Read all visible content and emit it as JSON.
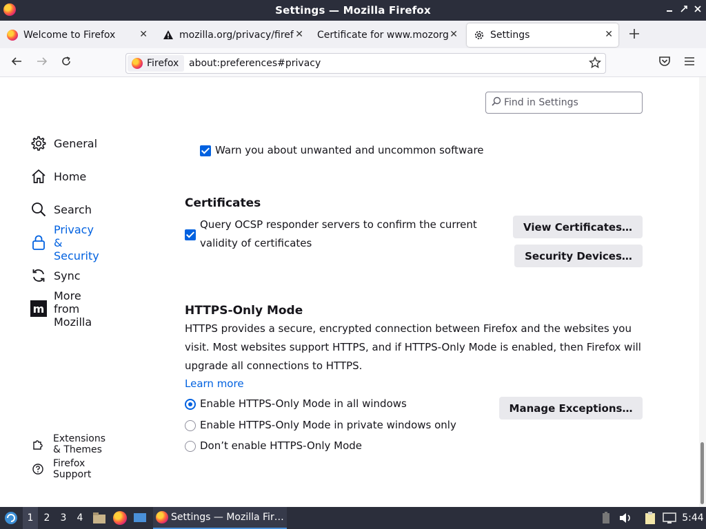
{
  "window": {
    "title": "Settings — Mozilla Firefox"
  },
  "tabs": [
    {
      "label": "Welcome to Firefox",
      "icon": "firefox-icon"
    },
    {
      "label": "mozilla.org/privacy/firefo",
      "icon": "warning-icon"
    },
    {
      "label": "Certificate for www.mozorg.m",
      "icon": "none"
    },
    {
      "label": "Settings",
      "icon": "gear-icon",
      "active": true
    }
  ],
  "urlbar": {
    "identity": "Firefox",
    "url": "about:preferences#privacy"
  },
  "search": {
    "placeholder": "Find in Settings"
  },
  "sidebar": {
    "items": [
      {
        "label": "General",
        "icon": "gear-icon"
      },
      {
        "label": "Home",
        "icon": "home-icon"
      },
      {
        "label": "Search",
        "icon": "search-icon"
      },
      {
        "label": "Privacy & Security",
        "icon": "lock-icon",
        "selected": true
      },
      {
        "label": "Sync",
        "icon": "sync-icon"
      },
      {
        "label": "More from Mozilla",
        "icon": "mozilla-icon"
      }
    ],
    "footer": [
      {
        "label": "Extensions & Themes",
        "icon": "puzzle-icon"
      },
      {
        "label": "Firefox Support",
        "icon": "help-icon"
      }
    ]
  },
  "security": {
    "warn_unwanted": {
      "label": "Warn you about unwanted and uncommon software",
      "checked": true
    }
  },
  "certificates": {
    "heading": "Certificates",
    "ocsp": {
      "label_line1": "Query OCSP responder servers to confirm the current",
      "label_line2": "validity of certificates",
      "checked": true
    },
    "view_button": "View Certificates…",
    "devices_button": "Security Devices…"
  },
  "https_only": {
    "heading": "HTTPS-Only Mode",
    "description": "HTTPS provides a secure, encrypted connection between Firefox and the websites you visit. Most websites support HTTPS, and if HTTPS-Only Mode is enabled, then Firefox will upgrade all connections to HTTPS.",
    "learn_more": "Learn more",
    "manage_button": "Manage Exceptions…",
    "options": [
      {
        "label": "Enable HTTPS-Only Mode in all windows",
        "selected": true
      },
      {
        "label": "Enable HTTPS-Only Mode in private windows only",
        "selected": false
      },
      {
        "label": "Don’t enable HTTPS-Only Mode",
        "selected": false
      }
    ]
  },
  "taskbar": {
    "workspaces": [
      "1",
      "2",
      "3",
      "4"
    ],
    "window_label": "Settings — Mozilla Fir…",
    "clock": "5:44"
  },
  "colors": {
    "accent": "#0061e0",
    "titlebar": "#2b2e3b",
    "button": "#e9e9ed"
  }
}
